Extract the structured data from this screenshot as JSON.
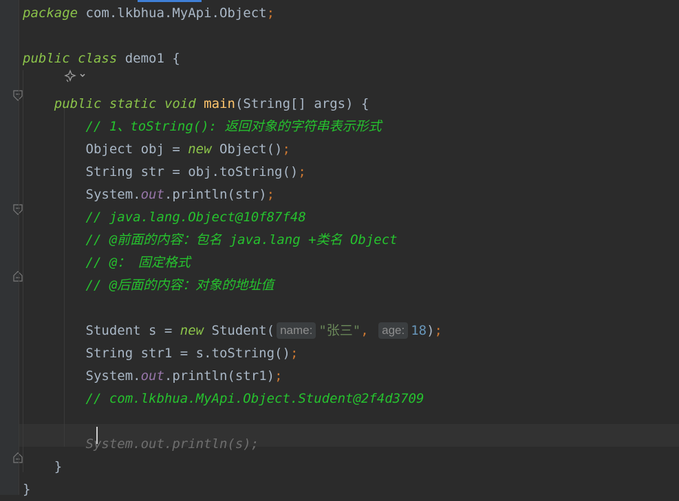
{
  "editor": {
    "lines": [
      {
        "tokens": [
          {
            "t": "package",
            "c": "kw2"
          },
          {
            "t": " com.lkbhua.MyApi.Object",
            "c": ""
          },
          {
            "t": ";",
            "c": "punc"
          }
        ]
      },
      {
        "tokens": []
      },
      {
        "tokens": [
          {
            "t": "public",
            "c": "kw2"
          },
          {
            "t": " ",
            "c": ""
          },
          {
            "t": "class",
            "c": "kw2"
          },
          {
            "t": " demo1 {",
            "c": ""
          }
        ]
      },
      {
        "tokens": []
      },
      {
        "tokens": [
          {
            "t": "    ",
            "c": ""
          },
          {
            "t": "public",
            "c": "kw2"
          },
          {
            "t": " ",
            "c": ""
          },
          {
            "t": "static",
            "c": "kw2"
          },
          {
            "t": " ",
            "c": ""
          },
          {
            "t": "void",
            "c": "kw2"
          },
          {
            "t": " ",
            "c": ""
          },
          {
            "t": "main",
            "c": "method"
          },
          {
            "t": "(String[] args) {",
            "c": ""
          }
        ]
      },
      {
        "tokens": [
          {
            "t": "        ",
            "c": ""
          },
          {
            "t": "// 1、toString(): 返回对象的字符串表示形式",
            "c": "cmt"
          }
        ]
      },
      {
        "tokens": [
          {
            "t": "        Object obj = ",
            "c": ""
          },
          {
            "t": "new",
            "c": "kw2"
          },
          {
            "t": " Object()",
            "c": ""
          },
          {
            "t": ";",
            "c": "punc"
          }
        ]
      },
      {
        "tokens": [
          {
            "t": "        String str = obj.toString()",
            "c": ""
          },
          {
            "t": ";",
            "c": "punc"
          }
        ]
      },
      {
        "tokens": [
          {
            "t": "        System.",
            "c": ""
          },
          {
            "t": "out",
            "c": "field"
          },
          {
            "t": ".println(str)",
            "c": ""
          },
          {
            "t": ";",
            "c": "punc"
          }
        ]
      },
      {
        "tokens": [
          {
            "t": "        ",
            "c": ""
          },
          {
            "t": "// java.lang.Object@10f87f48",
            "c": "cmt"
          }
        ]
      },
      {
        "tokens": [
          {
            "t": "        ",
            "c": ""
          },
          {
            "t": "// @前面的内容：包名 java.lang +类名 Object",
            "c": "cmt"
          }
        ]
      },
      {
        "tokens": [
          {
            "t": "        ",
            "c": ""
          },
          {
            "t": "// @： 固定格式",
            "c": "cmt"
          }
        ]
      },
      {
        "tokens": [
          {
            "t": "        ",
            "c": ""
          },
          {
            "t": "// @后面的内容：对象的地址值",
            "c": "cmt"
          }
        ]
      },
      {
        "tokens": []
      },
      {
        "tokens": [
          {
            "t": "        Student s = ",
            "c": ""
          },
          {
            "t": "new",
            "c": "kw2"
          },
          {
            "t": " Student(",
            "c": ""
          },
          {
            "t": "name:",
            "c": "hint"
          },
          {
            "t": "\"张三\"",
            "c": "str"
          },
          {
            "t": ",",
            "c": "punc"
          },
          {
            "t": " ",
            "c": ""
          },
          {
            "t": "age:",
            "c": "hint"
          },
          {
            "t": "18",
            "c": "num"
          },
          {
            "t": ")",
            "c": ""
          },
          {
            "t": ";",
            "c": "punc"
          }
        ]
      },
      {
        "tokens": [
          {
            "t": "        String str1 = s.toString()",
            "c": ""
          },
          {
            "t": ";",
            "c": "punc"
          }
        ]
      },
      {
        "tokens": [
          {
            "t": "        System.",
            "c": ""
          },
          {
            "t": "out",
            "c": "field"
          },
          {
            "t": ".println(str1)",
            "c": ""
          },
          {
            "t": ";",
            "c": "punc"
          }
        ]
      },
      {
        "tokens": [
          {
            "t": "        ",
            "c": ""
          },
          {
            "t": "// com.lkbhua.MyApi.Object.Student@2f4d3709",
            "c": "cmt"
          }
        ]
      },
      {
        "tokens": []
      },
      {
        "tokens": [
          {
            "t": "        ",
            "c": ""
          },
          {
            "t": "System.out.println(s);",
            "c": "ghost"
          }
        ]
      },
      {
        "tokens": [
          {
            "t": "    }",
            "c": ""
          }
        ]
      },
      {
        "tokens": [
          {
            "t": "}",
            "c": ""
          }
        ]
      }
    ]
  },
  "icons": {
    "ai_assistant": "ai-sparkle-icon",
    "fold": "fold-marker-icon"
  },
  "colors": {
    "background": "#2b2b2b",
    "keyword": "#8bc34a",
    "comment": "#26c22e",
    "punctuation": "#cc7832",
    "method": "#ffc66d",
    "number": "#6897bb",
    "string": "#6a8759",
    "field": "#9876aa"
  }
}
